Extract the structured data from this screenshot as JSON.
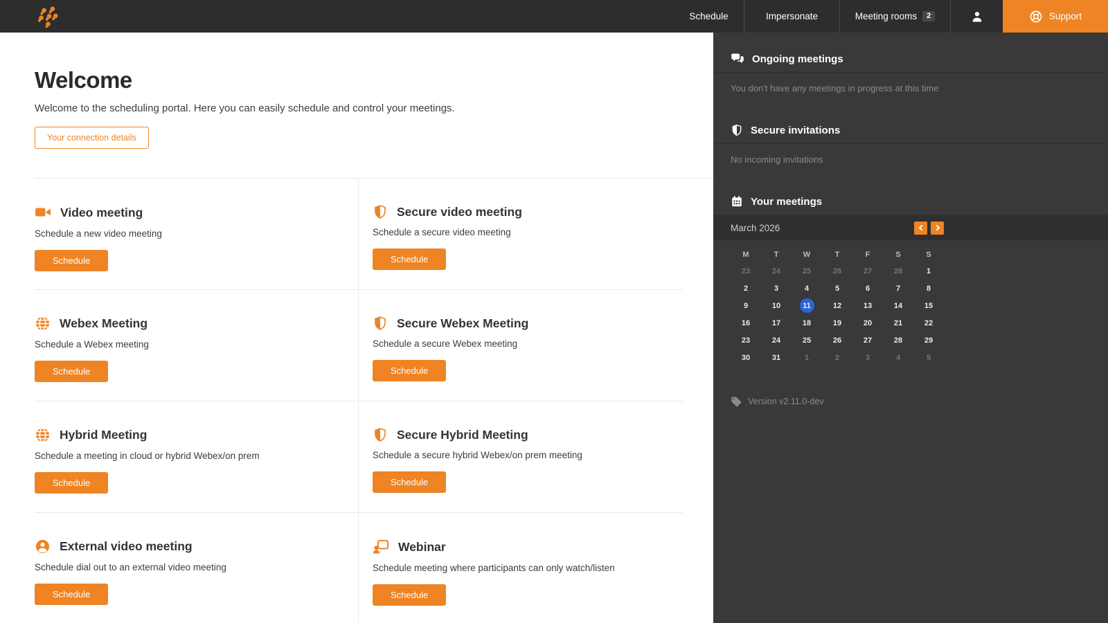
{
  "navbar": {
    "items": [
      {
        "label": "Schedule"
      },
      {
        "label": "Impersonate"
      },
      {
        "label": "Meeting rooms",
        "badge": "2"
      }
    ],
    "support_label": "Support"
  },
  "welcome": {
    "title": "Welcome",
    "subtitle": "Welcome to the scheduling portal. Here you can easily schedule and control your meetings.",
    "connection_button": "Your connection details"
  },
  "meeting_types": [
    {
      "icon": "video-camera-icon",
      "title": "Video meeting",
      "description": "Schedule a new video meeting",
      "button": "Schedule"
    },
    {
      "icon": "shield-icon",
      "title": "Secure video meeting",
      "description": "Schedule a secure video meeting",
      "button": "Schedule"
    },
    {
      "icon": "globe-icon",
      "title": "Webex Meeting",
      "description": "Schedule a Webex meeting",
      "button": "Schedule"
    },
    {
      "icon": "shield-icon",
      "title": "Secure Webex Meeting",
      "description": "Schedule a secure Webex meeting",
      "button": "Schedule"
    },
    {
      "icon": "globe-icon",
      "title": "Hybrid Meeting",
      "description": "Schedule a meeting in cloud or hybrid Webex/on prem",
      "button": "Schedule"
    },
    {
      "icon": "shield-icon",
      "title": "Secure Hybrid Meeting",
      "description": "Schedule a secure hybrid Webex/on prem meeting",
      "button": "Schedule"
    },
    {
      "icon": "person-icon",
      "title": "External video meeting",
      "description": "Schedule dial out to an external video meeting",
      "button": "Schedule"
    },
    {
      "icon": "webinar-icon",
      "title": "Webinar",
      "description": "Schedule meeting where participants can only watch/listen",
      "button": "Schedule"
    }
  ],
  "sidebar": {
    "ongoing_meetings": {
      "title": "Ongoing meetings",
      "empty_text": "You don't have any meetings in progress at this time"
    },
    "secure_invitations": {
      "title": "Secure invitations",
      "empty_text": "No incoming invitations"
    },
    "your_meetings": {
      "title": "Your meetings"
    },
    "calendar": {
      "month_label": "March 2026",
      "day_headers": [
        "M",
        "T",
        "W",
        "T",
        "F",
        "S",
        "S"
      ],
      "selected_day": "11",
      "days": [
        {
          "d": "23",
          "muted": true
        },
        {
          "d": "24",
          "muted": true
        },
        {
          "d": "25",
          "muted": true
        },
        {
          "d": "26",
          "muted": true
        },
        {
          "d": "27",
          "muted": true
        },
        {
          "d": "28",
          "muted": true
        },
        {
          "d": "1"
        },
        {
          "d": "2"
        },
        {
          "d": "3"
        },
        {
          "d": "4"
        },
        {
          "d": "5"
        },
        {
          "d": "6"
        },
        {
          "d": "7"
        },
        {
          "d": "8"
        },
        {
          "d": "9"
        },
        {
          "d": "10"
        },
        {
          "d": "11",
          "selected": true
        },
        {
          "d": "12"
        },
        {
          "d": "13"
        },
        {
          "d": "14"
        },
        {
          "d": "15"
        },
        {
          "d": "16"
        },
        {
          "d": "17"
        },
        {
          "d": "18"
        },
        {
          "d": "19"
        },
        {
          "d": "20"
        },
        {
          "d": "21"
        },
        {
          "d": "22"
        },
        {
          "d": "23"
        },
        {
          "d": "24"
        },
        {
          "d": "25"
        },
        {
          "d": "26"
        },
        {
          "d": "27"
        },
        {
          "d": "28"
        },
        {
          "d": "29"
        },
        {
          "d": "30"
        },
        {
          "d": "31"
        },
        {
          "d": "1",
          "muted": true
        },
        {
          "d": "2",
          "muted": true
        },
        {
          "d": "3",
          "muted": true
        },
        {
          "d": "4",
          "muted": true
        },
        {
          "d": "5",
          "muted": true
        }
      ]
    },
    "version": "Version v2.11.0-dev"
  },
  "colors": {
    "accent_orange": "#ee8424",
    "selected_day_blue": "#2b65d9",
    "navbar_bg": "#2d2d2d",
    "sidebar_bg": "#393939"
  }
}
